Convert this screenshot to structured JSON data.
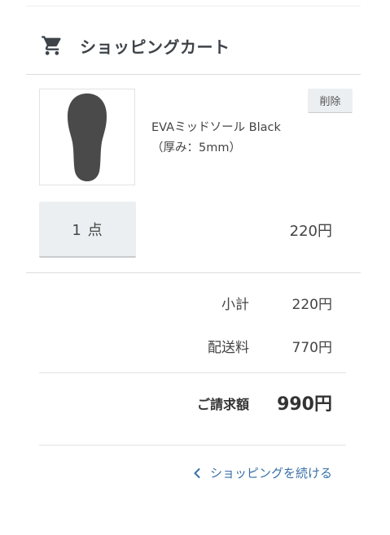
{
  "header": {
    "icon": "shopping-cart-icon",
    "title": "ショッピングカート"
  },
  "cart": {
    "items": [
      {
        "name_line1": "EVAミッドソール Black",
        "name_line2": "（厚み：5mm）",
        "image_icon": "insole-icon",
        "delete_label": "削除",
        "quantity_label": "1 点",
        "price": "220円"
      }
    ]
  },
  "summary": {
    "subtotal_label": "小計",
    "subtotal_value": "220円",
    "shipping_label": "配送料",
    "shipping_value": "770円",
    "total_label": "ご請求額",
    "total_value": "990円"
  },
  "footer": {
    "continue_icon": "chevron-left-icon",
    "continue_label": "ショッピングを続ける"
  },
  "colors": {
    "text": "#444444",
    "heading": "#3d4349",
    "button_bg": "#eceff1",
    "link": "#3a71a8",
    "divider": "#dddddd"
  }
}
